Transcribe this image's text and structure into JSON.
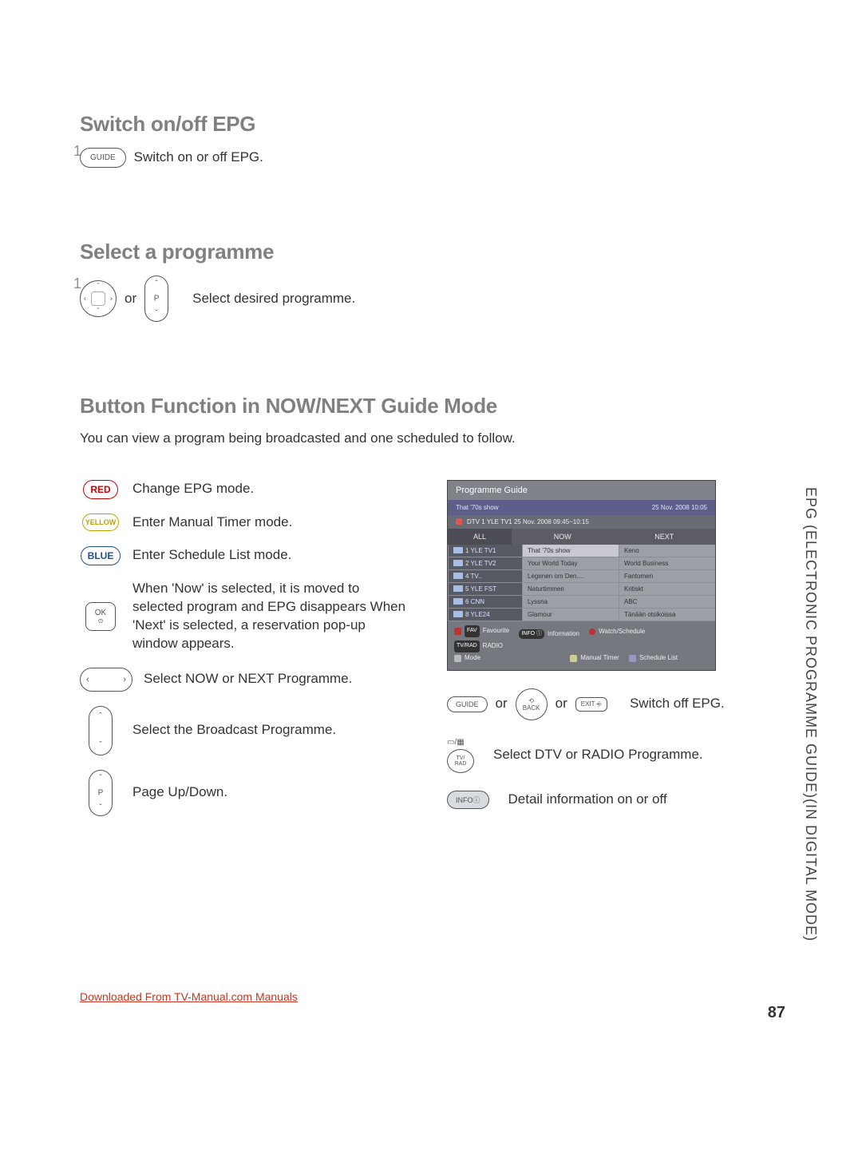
{
  "headings": {
    "h1": "Switch on/off EPG",
    "h2": "Select a programme",
    "h3": "Button Function in NOW/NEXT Guide Mode"
  },
  "intro3": "You can view a program being broadcasted and one scheduled to follow.",
  "step1": {
    "btn": "GUIDE",
    "desc": "Switch on or off EPG."
  },
  "step2": {
    "or": "or",
    "desc": "Select desired programme."
  },
  "fns": {
    "red": {
      "label": "RED",
      "desc": "Change EPG mode."
    },
    "yellow": {
      "label": "YELLOW",
      "desc": "Enter Manual Timer mode."
    },
    "blue": {
      "label": "BLUE",
      "desc": "Enter Schedule List mode."
    },
    "ok": {
      "label": "OK",
      "dot": "⊙",
      "desc": "When 'Now' is selected, it is moved to selected program and EPG disappears When 'Next' is selected, a reservation pop-up window appears."
    },
    "lr": {
      "desc": "Select NOW or NEXT Programme."
    },
    "ud": {
      "desc": "Select the Broadcast Programme."
    },
    "p": {
      "label": "P",
      "desc": "Page Up/Down."
    }
  },
  "guide": {
    "title": "Programme Guide",
    "show": "That '70s show",
    "date": "25 Nov. 2008 10:05",
    "sub": "DTV  1 YLE TV1 25 Nov. 2008 09:45~10:15",
    "cols": {
      "all": "ALL",
      "now": "NOW",
      "next": "NEXT"
    },
    "rows": [
      {
        "ch": "1  YLE TV1",
        "now": "That '70s show",
        "next": "Keno"
      },
      {
        "ch": "2  YLE TV2",
        "now": "Your World Today",
        "next": "World Business"
      },
      {
        "ch": "4  TV..",
        "now": "Legenen om Den....",
        "next": "Fantomen"
      },
      {
        "ch": "5  YLE FST",
        "now": "Naturtimmen",
        "next": "Kritiskt"
      },
      {
        "ch": "6  CNN",
        "now": "Lyssna",
        "next": "ABC"
      },
      {
        "ch": "8  YLE24",
        "now": "Glamour",
        "next": "Tänään otsikoissa"
      }
    ],
    "legend": {
      "fav": "Favourite",
      "info": "Information",
      "watch": "Watch/Schedule",
      "tvrad": "RADIO",
      "mode": "Mode",
      "manual": "Manual Timer",
      "sched": "Schedule List",
      "favlbl": "FAV",
      "infolbl": "INFO ⓘ",
      "tvradlbl": "TV/RAD"
    }
  },
  "right": {
    "r1": {
      "guide": "GUIDE",
      "back": "BACK",
      "exit": "EXIT",
      "or": "or",
      "desc": "Switch off EPG."
    },
    "r2": {
      "tvrad": "TV/\nRAD",
      "desc": "Select DTV or RADIO Programme."
    },
    "r3": {
      "info": "INFOⓘ",
      "desc": "Detail information on or off"
    }
  },
  "side": "EPG (ELECTRONIC PROGRAMME GUIDE)(IN DIGITAL MODE)",
  "page": "87",
  "footer": "Downloaded From TV-Manual.com Manuals"
}
